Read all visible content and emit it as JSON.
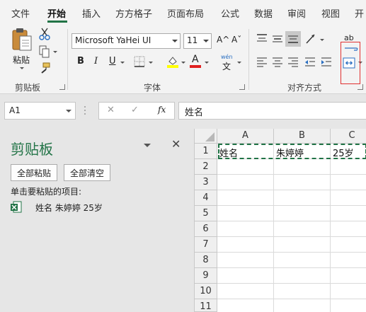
{
  "ribbon_tabs": [
    {
      "label": "文件",
      "active": false
    },
    {
      "label": "开始",
      "active": true
    },
    {
      "label": "插入",
      "active": false
    },
    {
      "label": "方方格子",
      "active": false
    },
    {
      "label": "页面布局",
      "active": false
    },
    {
      "label": "公式",
      "active": false
    },
    {
      "label": "数据",
      "active": false
    },
    {
      "label": "审阅",
      "active": false
    },
    {
      "label": "视图",
      "active": false
    },
    {
      "label": "开",
      "active": false
    }
  ],
  "ribbon": {
    "clipboard": {
      "paste_label": "粘贴",
      "group_label": "剪贴板",
      "icons": [
        "paste-icon",
        "cut-icon",
        "copy-icon",
        "format-painter-icon"
      ]
    },
    "font": {
      "group_label": "字体",
      "font_name": "Microsoft YaHei UI",
      "font_size": "11",
      "grow_label": "A^",
      "shrink_label": "Aˇ",
      "bold_label": "B",
      "italic_label": "I",
      "underline_label": "U",
      "wen_label": "wén",
      "wen_char": "文",
      "font_color_label": "A",
      "highlight_color": "#ffff00",
      "font_color": "#e02020"
    },
    "alignment": {
      "group_label": "对齐方式",
      "wrap_icon_label": "ab"
    }
  },
  "formula_bar": {
    "name_box": "A1",
    "cancel_symbol": "✕",
    "enter_symbol": "✓",
    "fx_label": "fx",
    "formula": "姓名"
  },
  "clipboard_pane": {
    "title": "剪贴板",
    "paste_all_label": "全部粘贴",
    "clear_all_label": "全部清空",
    "hint": "单击要粘贴的项目:",
    "items": [
      {
        "text": "姓名 朱婷婷 25岁",
        "icon": "excel-icon"
      }
    ]
  },
  "sheet": {
    "columns": [
      "A",
      "B",
      "C"
    ],
    "rows": [
      "1",
      "2",
      "3",
      "4",
      "5",
      "6",
      "7",
      "8",
      "9",
      "10",
      "11"
    ],
    "cells": [
      [
        "姓名",
        "朱婷婷",
        "25岁"
      ]
    ]
  },
  "colors": {
    "accent": "#217346",
    "highlight_box": "#e03030"
  }
}
